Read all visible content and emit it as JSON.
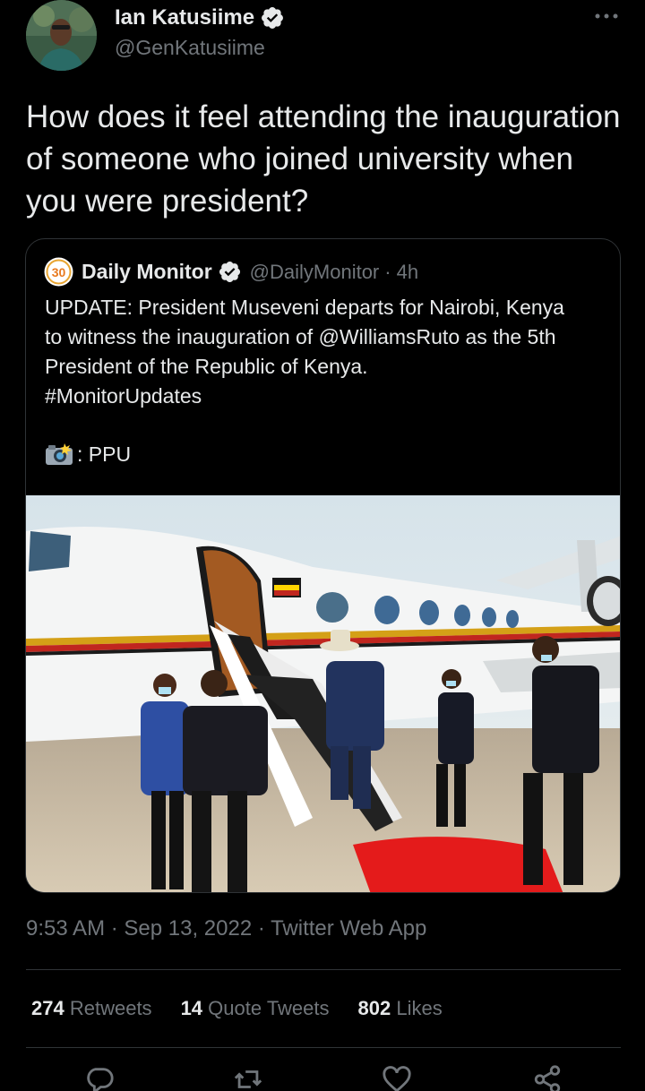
{
  "author": {
    "name": "Ian Katusiime",
    "handle": "@GenKatusiime"
  },
  "tweet": {
    "text": "How does it feel attending the inauguration of someone who joined university when you were president?"
  },
  "quoted": {
    "name": "Daily Monitor",
    "handle": "@DailyMonitor",
    "separator": "·",
    "time": "4h",
    "logo_text": "30",
    "body_lines": [
      "UPDATE: President Museveni departs for Nairobi, Kenya",
      "to witness the inauguration of @WilliamsRuto as the 5th",
      "President of the Republic of Kenya.",
      "#MonitorUpdates"
    ],
    "credit": ": PPU"
  },
  "meta": {
    "line": "9:53 AM · Sep 13, 2022 · Twitter Web App"
  },
  "stats": [
    {
      "count": "274",
      "label": "Retweets"
    },
    {
      "count": "14",
      "label": "Quote Tweets"
    },
    {
      "count": "802",
      "label": "Likes"
    }
  ],
  "colors": {
    "background": "#000000",
    "text": "#e7e9ea",
    "secondary": "#71767b",
    "border": "#2f3336",
    "verified": "#e7e9ea"
  },
  "icons": [
    "more-icon",
    "verified-icon",
    "camera-icon",
    "reply-icon",
    "retweet-icon",
    "like-icon",
    "share-icon"
  ]
}
